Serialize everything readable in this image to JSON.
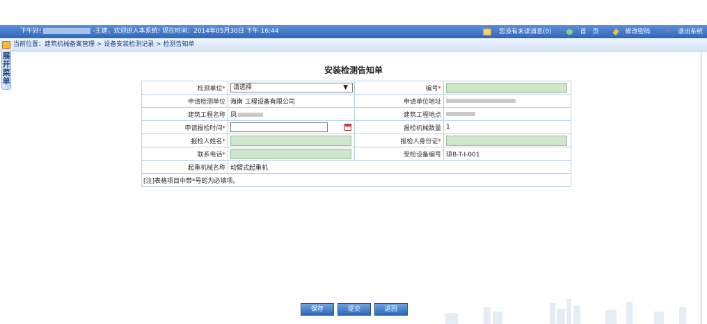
{
  "topbar": {
    "greeting": "下午好!",
    "welcome": "-王建，欢迎进入本系统!  现在时间：2014年05月30日 下午 16:44",
    "messages": "您没有未读消息(0)",
    "home": "首　页",
    "change_password": "修改密码",
    "logout": "退出系统"
  },
  "breadcrumb": {
    "text": "当前位置：建筑机械备案管理 > 设备安装检测记录 > 检测告知单"
  },
  "sidetab": {
    "chars": [
      "展",
      "开",
      "菜",
      "单"
    ]
  },
  "form": {
    "title": "安装检测告知单",
    "inspection_unit_label": "检测单位",
    "inspection_unit_value": "请选择",
    "number_label": "编号",
    "applicant_unit_label": "申请检测单位",
    "applicant_unit_value": "海南     工程设备有限公司",
    "applicant_address_label": "申请单位地址",
    "project_name_label": "建筑工程名称",
    "project_name_value": "凤",
    "project_location_label": "建筑工程地点",
    "report_time_label": "申请报检时间",
    "machine_count_label": "报检机械数量",
    "machine_count_value": "1",
    "reporter_name_label": "报检人姓名",
    "reporter_id_label": "报检人身份证",
    "phone_label": "联系电话",
    "device_no_label": "受检设备编号",
    "device_no_value": "琼B-T-I-001",
    "crane_name_label": "起重机械名称",
    "crane_name_value": "动臂式起重机",
    "note": "[注]表格项目中带*号的为必填项。",
    "required_mark": "*"
  },
  "buttons": {
    "save": "保存",
    "submit": "提交",
    "back": "返回"
  },
  "colors": {
    "topbar": "#2f66b9",
    "input_green": "#cde7cc",
    "table_border": "#b9cfe8",
    "required": "#e00000"
  }
}
